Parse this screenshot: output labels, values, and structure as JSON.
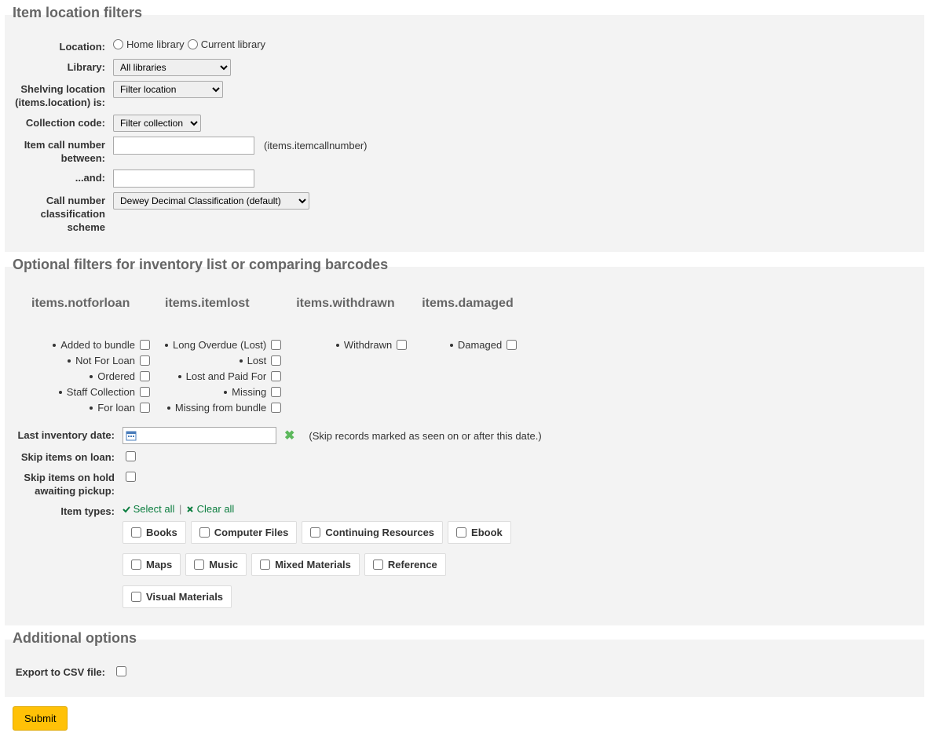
{
  "sections": {
    "location": {
      "legend": "Item location filters",
      "location_label": "Location:",
      "home_library": "Home library",
      "current_library": "Current library",
      "library_label": "Library:",
      "library_selected": "All libraries",
      "shelving_label": "Shelving location (items.location) is:",
      "shelving_selected": "Filter location",
      "collection_label": "Collection code:",
      "collection_selected": "Filter collection",
      "callnum_between_label": "Item call number between:",
      "callnum_hint": "(items.itemcallnumber)",
      "and_label": "...and:",
      "scheme_label": "Call number classification scheme",
      "scheme_selected": "Dewey Decimal Classification (default)"
    },
    "optional": {
      "legend": "Optional filters for inventory list or comparing barcodes",
      "cols": {
        "notforloan": {
          "header": "items.notforloan",
          "items": [
            "Added to bundle",
            "Not For Loan",
            "Ordered",
            "Staff Collection",
            "For loan"
          ]
        },
        "itemlost": {
          "header": "items.itemlost",
          "items": [
            "Long Overdue (Lost)",
            "Lost",
            "Lost and Paid For",
            "Missing",
            "Missing from bundle"
          ]
        },
        "withdrawn": {
          "header": "items.withdrawn",
          "items": [
            "Withdrawn"
          ]
        },
        "damaged": {
          "header": "items.damaged",
          "items": [
            "Damaged"
          ]
        }
      },
      "last_inventory_label": "Last inventory date:",
      "last_inventory_hint": "(Skip records marked as seen on or after this date.)",
      "skip_loan_label": "Skip items on loan:",
      "skip_hold_label": "Skip items on hold awaiting pickup:",
      "item_types_label": "Item types:",
      "select_all": "Select all",
      "clear_all": "Clear all",
      "item_types": [
        "Books",
        "Computer Files",
        "Continuing Resources",
        "Ebook",
        "Maps",
        "Music",
        "Mixed Materials",
        "Reference",
        "Visual Materials"
      ]
    },
    "additional": {
      "legend": "Additional options",
      "export_label": "Export to CSV file:"
    }
  },
  "submit_label": "Submit"
}
